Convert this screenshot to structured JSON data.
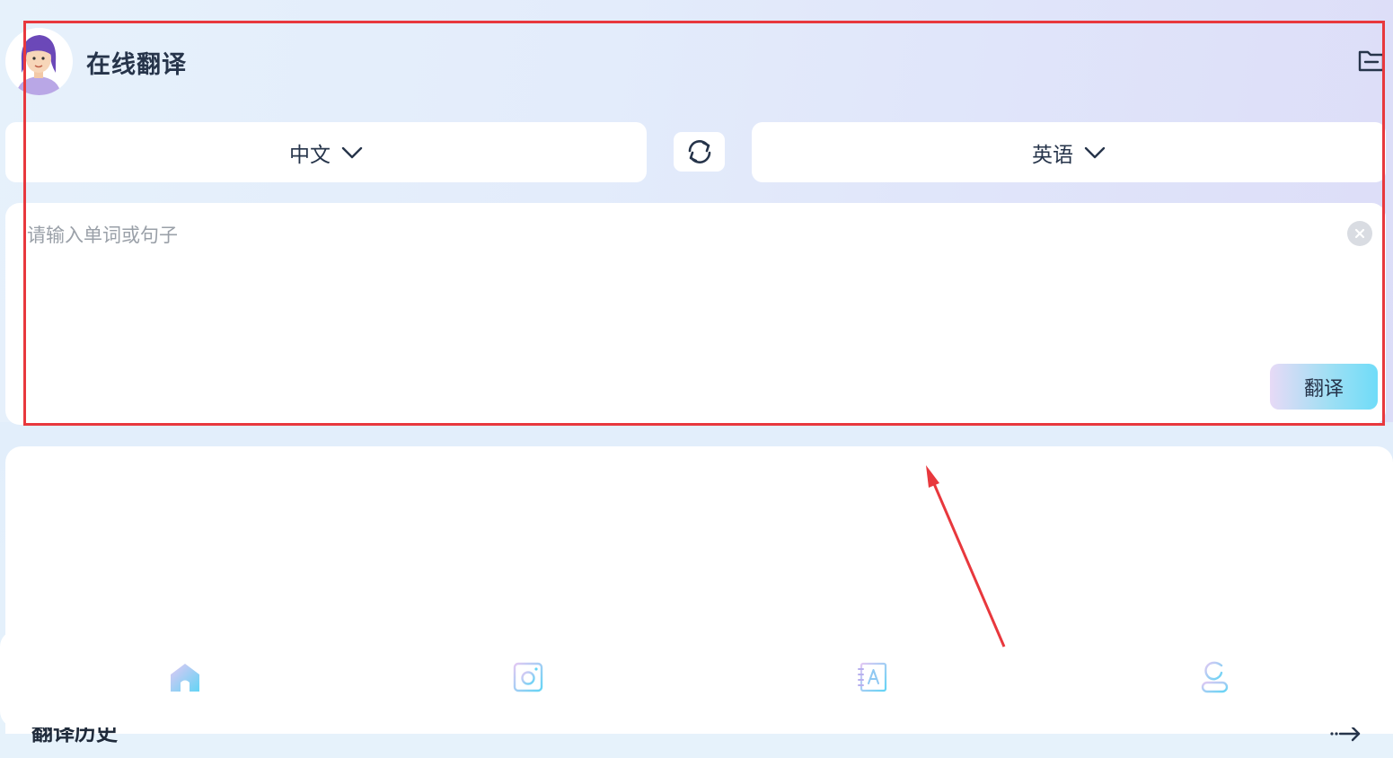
{
  "header": {
    "title": "在线翻译",
    "avatar_icon": "user-avatar",
    "folder_icon": "folder-icon"
  },
  "languages": {
    "source": "中文",
    "target": "英语",
    "swap_icon": "swap-icon"
  },
  "input": {
    "value": "",
    "placeholder": "请输入单词或句子",
    "clear_icon": "clear-icon",
    "translate_label": "翻译"
  },
  "history": {
    "title": "翻译历史",
    "more_icon": "arrow-right-icon"
  },
  "bottom_nav": [
    {
      "icon": "home-icon",
      "active": true
    },
    {
      "icon": "camera-icon",
      "active": false
    },
    {
      "icon": "dictionary-icon",
      "active": false
    },
    {
      "icon": "profile-icon",
      "active": false
    }
  ],
  "colors": {
    "accent_gradient_start": "#e7daf6",
    "accent_gradient_end": "#6fdcf8",
    "annotation_red": "#e8383d"
  }
}
